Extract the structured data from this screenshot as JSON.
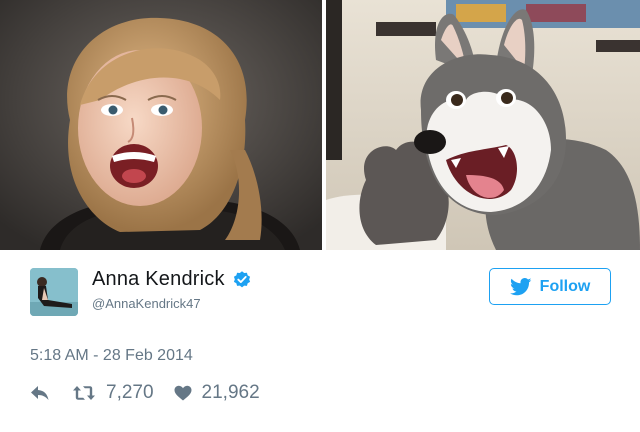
{
  "tweet": {
    "display_name": "Anna Kendrick",
    "handle": "@AnnaKendrick47",
    "verified": true,
    "timestamp": "5:18 AM - 28 Feb 2014",
    "retweet_count": "7,270",
    "like_count": "21,962"
  },
  "follow_button": {
    "label": "Follow",
    "icon": "twitter-bird-icon"
  },
  "icons": {
    "reply": "reply-icon",
    "retweet": "retweet-icon",
    "like": "heart-icon",
    "verified": "verified-badge-icon"
  },
  "colors": {
    "accent": "#1da1f2",
    "verified": "#1da1f2",
    "text_primary": "#14171a",
    "text_secondary": "#657786"
  },
  "images": [
    {
      "description": "woman with blonde hair excited expression"
    },
    {
      "description": "husky dog with open mouth excited expression"
    }
  ]
}
